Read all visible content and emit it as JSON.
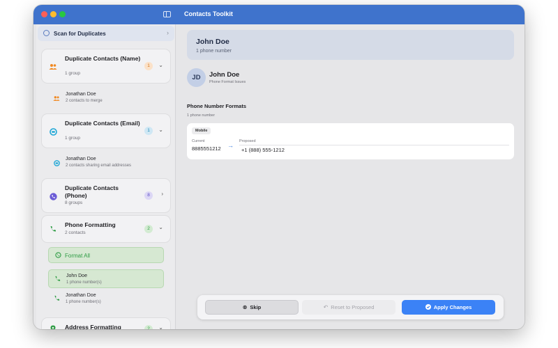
{
  "window": {
    "title": "Contacts Toolkit"
  },
  "sidebar": {
    "scan": {
      "label": "Scan for Duplicates"
    },
    "groups": [
      {
        "title": "Duplicate Contacts (Name)",
        "subtitle": "1 group",
        "badge": "1",
        "icon": "people-icon",
        "color": "#f08a24",
        "items": [
          {
            "name": "Jonathan Doe",
            "detail": "2 contacts to merge"
          }
        ]
      },
      {
        "title": "Duplicate Contacts (Email)",
        "subtitle": "1 group",
        "badge": "1",
        "icon": "email-icon",
        "color": "#1fa7d6",
        "items": [
          {
            "name": "Jonathan Doe",
            "detail": "2 contacts sharing email addresses"
          }
        ]
      },
      {
        "title": "Duplicate Contacts (Phone)",
        "subtitle": "8 groups",
        "badge": "8",
        "icon": "phone-icon",
        "color": "#6b5bd6"
      },
      {
        "title": "Phone Formatting",
        "subtitle": "2 contacts",
        "badge": "2",
        "icon": "phone-icon",
        "color": "#2e9c44",
        "format_all_label": "Format All",
        "items": [
          {
            "name": "John Doe",
            "detail": "1 phone number(s)"
          },
          {
            "name": "Jonathan Doe",
            "detail": "1 phone number(s)"
          }
        ]
      },
      {
        "title": "Address Formatting",
        "badge": "2",
        "icon": "location-pin-icon",
        "color": "#2e9c44"
      }
    ]
  },
  "main": {
    "header": {
      "name": "John Doe",
      "subtitle": "1 phone number"
    },
    "contact": {
      "initials": "JD",
      "name": "John Doe",
      "subtitle": "Phone Format Issues"
    },
    "section": {
      "title": "Phone Number Formats",
      "subtitle": "1 phone number"
    },
    "format": {
      "type": "Mobile",
      "current_label": "Current",
      "current_value": "8885551212",
      "proposed_label": "Proposed",
      "proposed_value": "+1 (888) 555-1212"
    },
    "actions": {
      "skip": "Skip",
      "reset": "Reset to Proposed",
      "apply": "Apply Changes"
    }
  },
  "colors": {
    "titlebar": "#3f73cc",
    "accent": "#3b82f6",
    "success": "#2e9c44"
  }
}
